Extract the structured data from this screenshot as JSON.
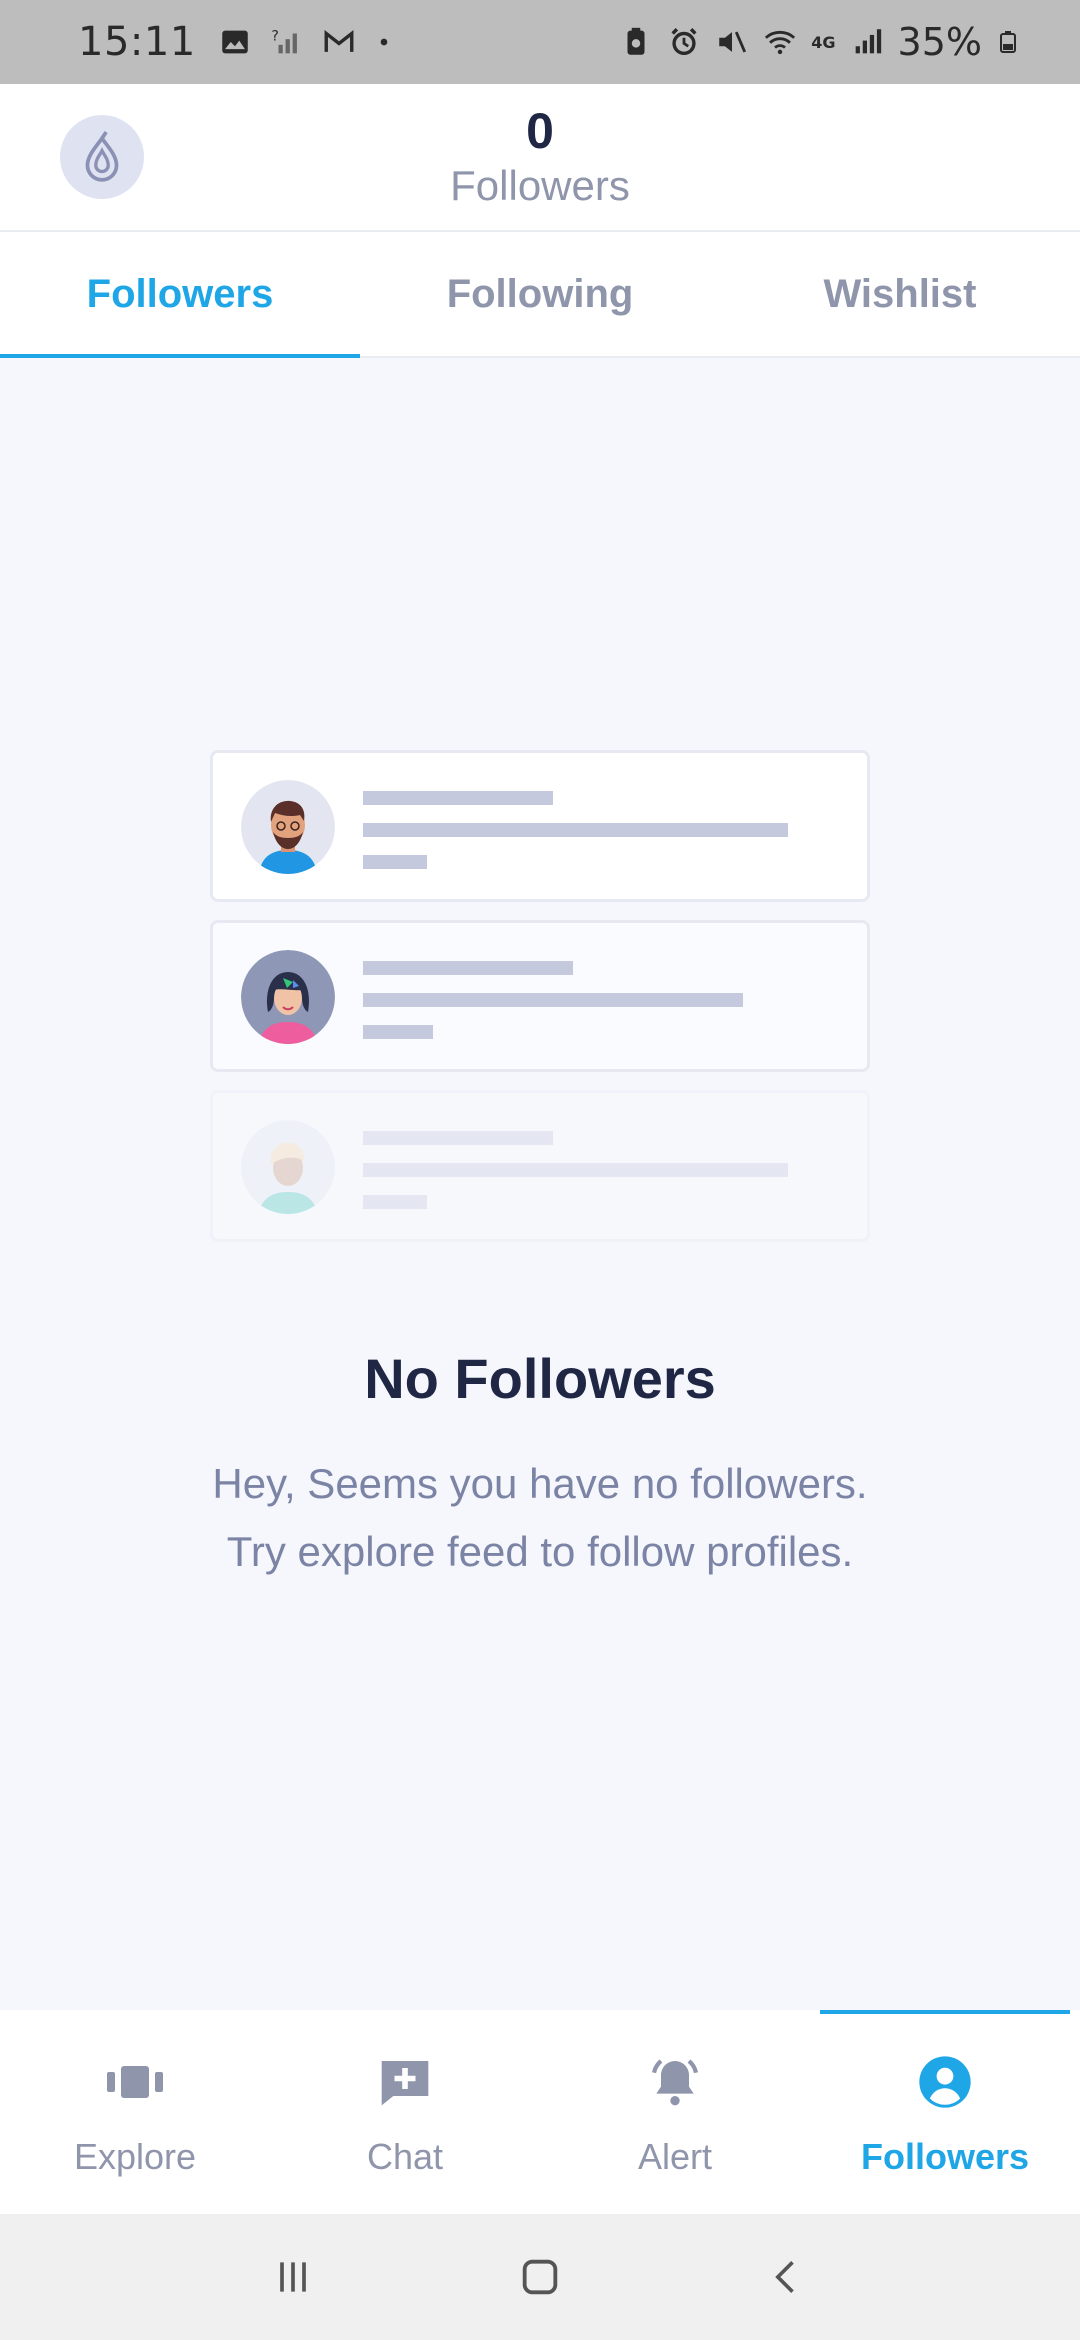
{
  "status_bar": {
    "time": "15:11",
    "battery": "35%",
    "network_label": "4G"
  },
  "header": {
    "count": "0",
    "label": "Followers"
  },
  "tabs": [
    {
      "label": "Followers",
      "active": true
    },
    {
      "label": "Following",
      "active": false
    },
    {
      "label": "Wishlist",
      "active": false
    }
  ],
  "empty_state": {
    "title": "No Followers",
    "message": "Hey, Seems you have no followers. Try explore feed to follow profiles."
  },
  "bottom_nav": [
    {
      "label": "Explore",
      "icon": "explore-icon",
      "active": false
    },
    {
      "label": "Chat",
      "icon": "chat-icon",
      "active": false
    },
    {
      "label": "Alert",
      "icon": "bell-icon",
      "active": false
    },
    {
      "label": "Followers",
      "icon": "user-icon",
      "active": true
    }
  ],
  "colors": {
    "accent": "#1fa6e6",
    "inactive": "#8f95ab",
    "title": "#1f2744",
    "background": "#f5f7fc"
  }
}
